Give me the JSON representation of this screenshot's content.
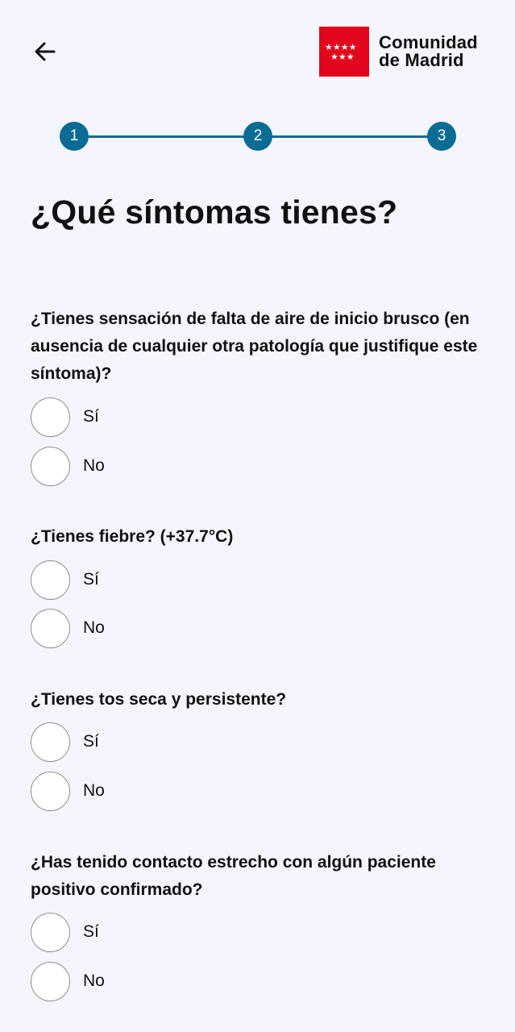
{
  "header": {
    "back_icon": "arrow-left-icon",
    "logo": {
      "line1": "Comunidad",
      "line2": "de Madrid",
      "flag_color": "#e3051b",
      "flag_icon": "seven-stars-flag"
    }
  },
  "stepper": {
    "color": "#0a6c94",
    "steps": [
      "1",
      "2",
      "3"
    ]
  },
  "title": "¿Qué síntomas tienes?",
  "questions": [
    {
      "text": "¿Tienes sensación de falta de aire de inicio brusco (en ausencia de cualquier otra patología que justifique este síntoma)?",
      "options": [
        "Sí",
        "No"
      ]
    },
    {
      "text": "¿Tienes fiebre? (+37.7°C)",
      "options": [
        "Sí",
        "No"
      ]
    },
    {
      "text": "¿Tienes tos seca y persistente?",
      "options": [
        "Sí",
        "No"
      ]
    },
    {
      "text": "¿Has tenido contacto estrecho con algún paciente positivo confirmado?",
      "options": [
        "Sí",
        "No"
      ]
    }
  ]
}
